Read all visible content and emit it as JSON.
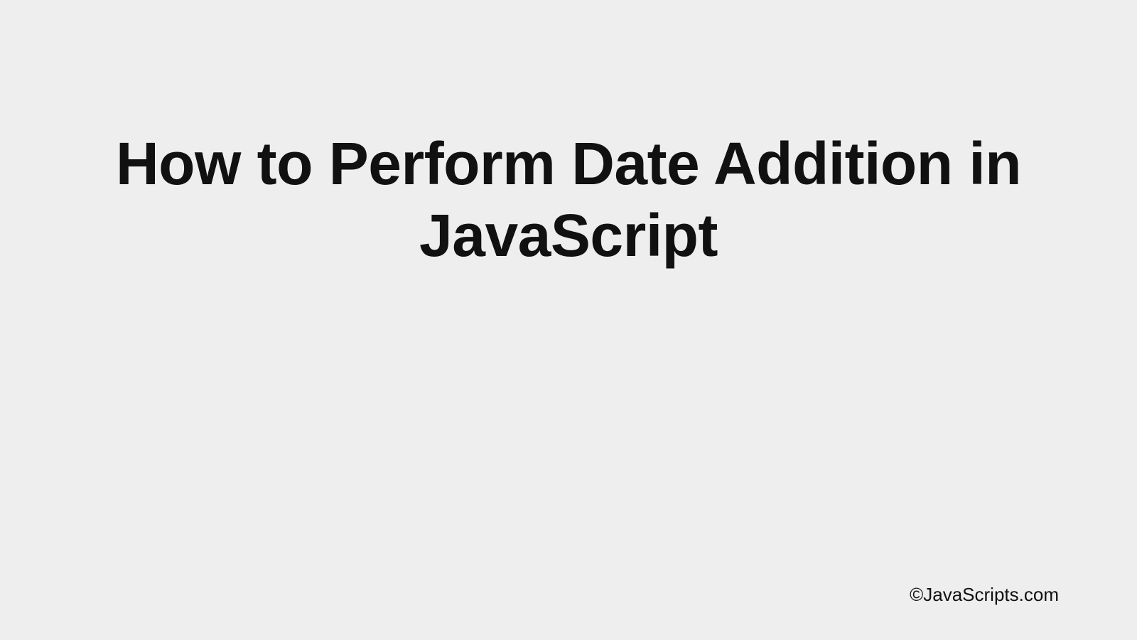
{
  "title": "How to Perform Date Addition in JavaScript",
  "attribution": "©JavaScripts.com"
}
